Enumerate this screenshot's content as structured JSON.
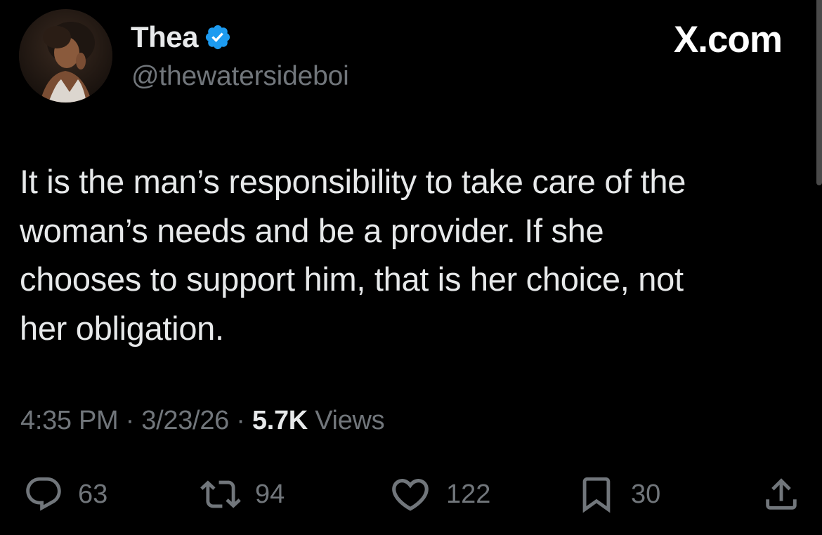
{
  "author": {
    "display_name": "Thea",
    "handle": "@thewatersideboi",
    "verified": true,
    "avatar_icon": "profile-photo"
  },
  "brand": {
    "text": "X.com"
  },
  "tweet": {
    "lines": [
      "It is the man’s responsibility to take care of the",
      "woman’s needs and be a provider. If she",
      "chooses to support him, that is her choice, not",
      "her obligation."
    ]
  },
  "meta": {
    "time": "4:35 PM",
    "separator": " · ",
    "date": "3/23/26",
    "views_count": "5.7K",
    "views_label": "Views"
  },
  "actions": {
    "replies": "63",
    "reposts": "94",
    "likes": "122",
    "bookmarks": "30"
  },
  "colors": {
    "background": "#000000",
    "primary_text": "#e7e9ea",
    "secondary_text": "#71767b",
    "verified_badge": "#1d9bf0"
  }
}
